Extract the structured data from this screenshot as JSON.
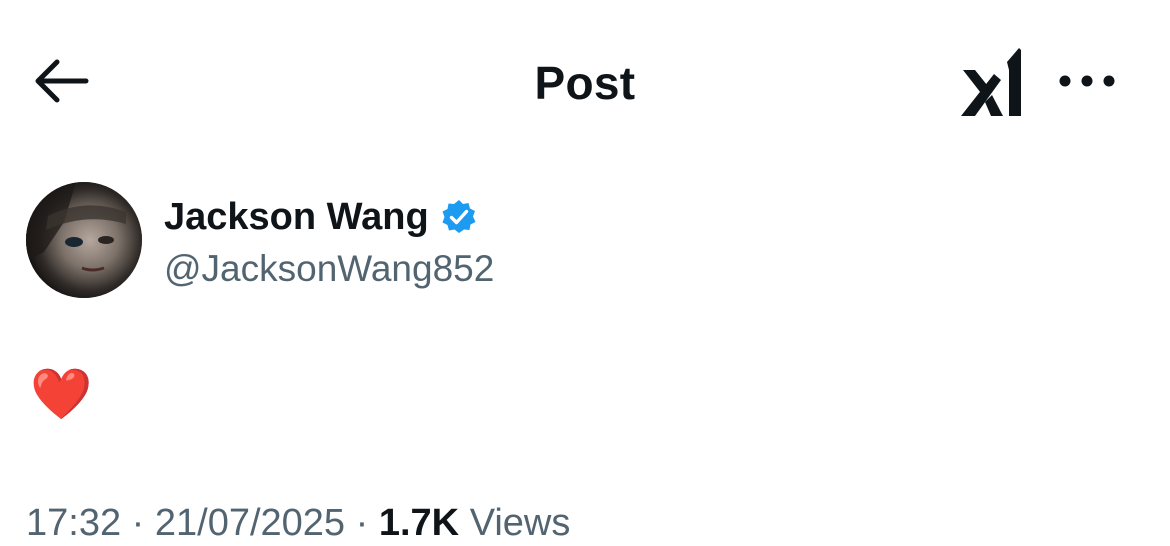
{
  "header": {
    "title": "Post",
    "back_icon": "arrow-left-icon",
    "grok_icon": "grok-logo-icon",
    "more_icon": "more-horizontal-icon"
  },
  "author": {
    "display_name": "Jackson Wang",
    "handle": "@JacksonWang852",
    "verified": true,
    "verified_color": "#1d9bf0"
  },
  "post": {
    "text": "❤️"
  },
  "meta": {
    "time": "17:32",
    "date": "21/07/2025",
    "views_count": "1.7K",
    "views_label": "Views"
  },
  "colors": {
    "text_primary": "#0f1419",
    "text_secondary": "#536471",
    "accent": "#1d9bf0"
  }
}
